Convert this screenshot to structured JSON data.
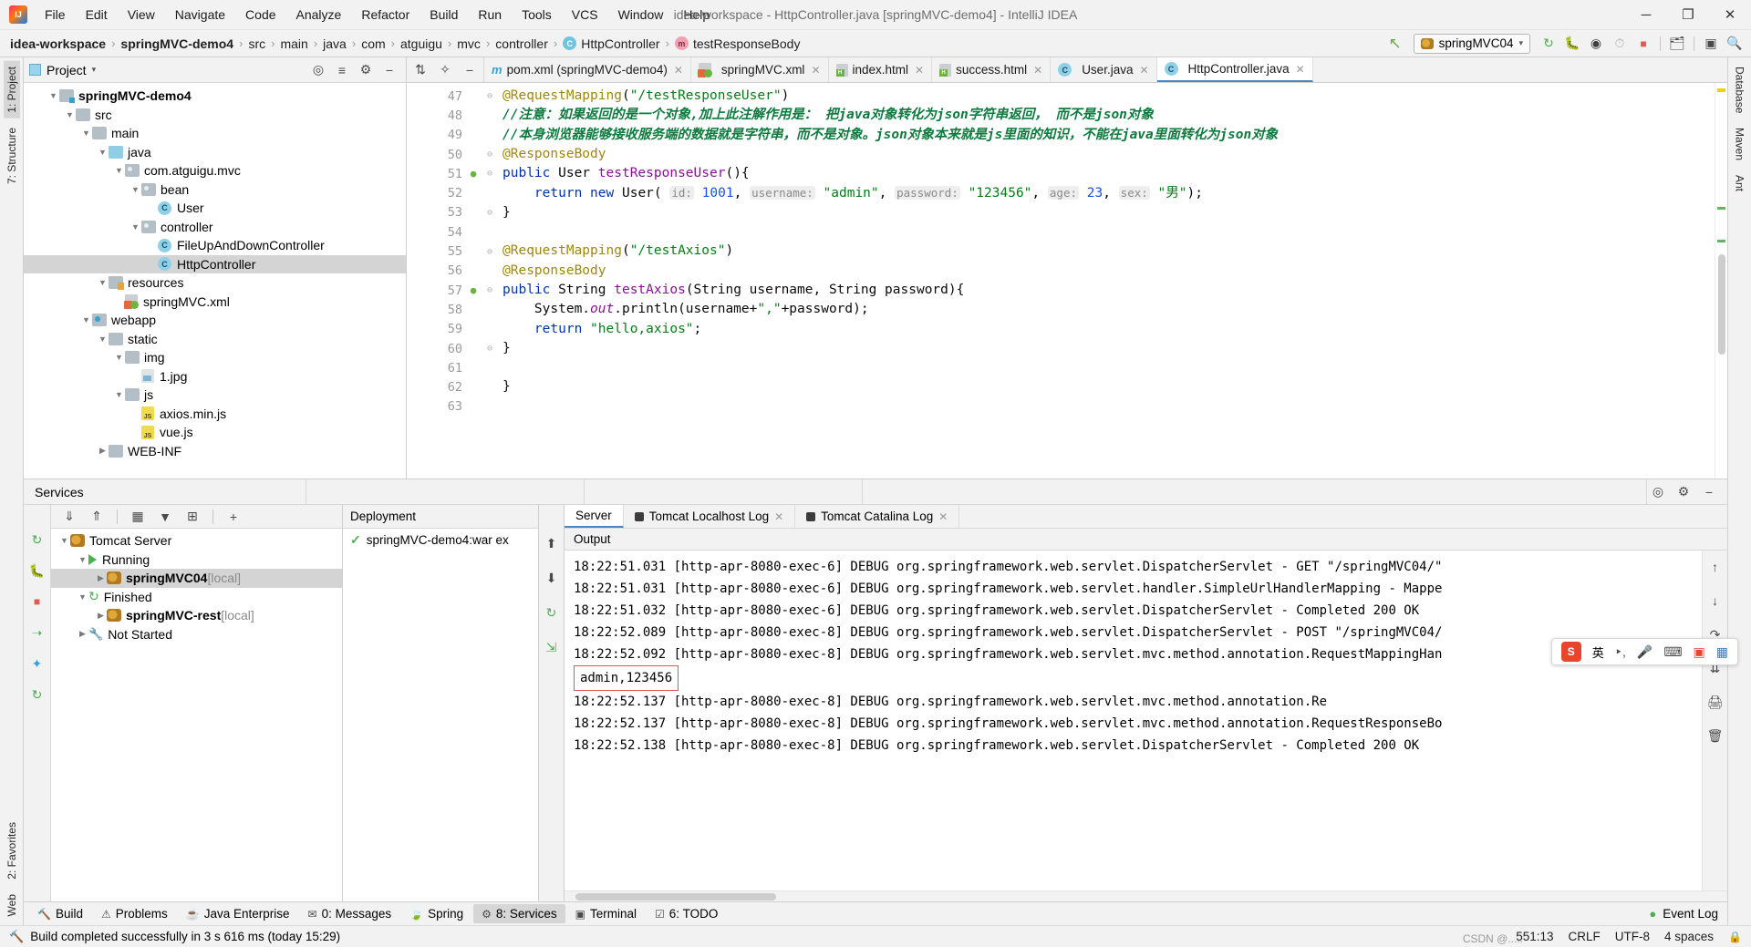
{
  "titlebar": {
    "logo": "intellij-logo",
    "menus": [
      "File",
      "Edit",
      "View",
      "Navigate",
      "Code",
      "Analyze",
      "Refactor",
      "Build",
      "Run",
      "Tools",
      "VCS",
      "Window",
      "Help"
    ],
    "window_title": "idea-workspace - HttpController.java [springMVC-demo4] - IntelliJ IDEA",
    "minimize": "─",
    "maximize": "❐",
    "close": "✕"
  },
  "navbar": {
    "crumbs": [
      {
        "label": "idea-workspace",
        "bold": true,
        "badge": ""
      },
      {
        "label": "springMVC-demo4",
        "bold": true,
        "badge": ""
      },
      {
        "label": "src",
        "bold": false,
        "badge": ""
      },
      {
        "label": "main",
        "bold": false,
        "badge": ""
      },
      {
        "label": "java",
        "bold": false,
        "badge": ""
      },
      {
        "label": "com",
        "bold": false,
        "badge": ""
      },
      {
        "label": "atguigu",
        "bold": false,
        "badge": ""
      },
      {
        "label": "mvc",
        "bold": false,
        "badge": ""
      },
      {
        "label": "controller",
        "bold": false,
        "badge": ""
      },
      {
        "label": "HttpController",
        "bold": false,
        "badge": "C"
      },
      {
        "label": "testResponseBody",
        "bold": false,
        "badge": "m"
      }
    ],
    "separator": "›",
    "run_config": "springMVC04",
    "run_config_caret": "▾",
    "actions": [
      "rerun-icon",
      "debug-icon",
      "run-with-coverage-icon",
      "profile-icon",
      "stop-icon",
      "build-project-icon",
      "terminal-icon",
      "search-everywhere-icon"
    ],
    "back_arrow": "↖"
  },
  "left_strip": {
    "top": [
      "1: Project",
      "7: Structure"
    ],
    "bottom": [
      "2: Favorites",
      "Web"
    ]
  },
  "right_strip": {
    "items": [
      "Database",
      "Maven",
      "Ant"
    ]
  },
  "project_panel": {
    "title": "Project",
    "caret": "▾",
    "header_actions": [
      "locate-icon",
      "collapse-all-icon",
      "settings-icon",
      "hide-icon"
    ],
    "tree": [
      {
        "depth": 1,
        "label": "springMVC-demo4",
        "icon": "module-folder",
        "arrow": "▼",
        "bold": true,
        "selected": false
      },
      {
        "depth": 2,
        "label": "src",
        "icon": "folder",
        "arrow": "▼",
        "bold": false,
        "selected": false
      },
      {
        "depth": 3,
        "label": "main",
        "icon": "folder",
        "arrow": "▼",
        "bold": false,
        "selected": false
      },
      {
        "depth": 4,
        "label": "java",
        "icon": "source-folder",
        "arrow": "▼",
        "bold": false,
        "selected": false
      },
      {
        "depth": 5,
        "label": "com.atguigu.mvc",
        "icon": "package",
        "arrow": "▼",
        "bold": false,
        "selected": false
      },
      {
        "depth": 6,
        "label": "bean",
        "icon": "package",
        "arrow": "▼",
        "bold": false,
        "selected": false
      },
      {
        "depth": 7,
        "label": "User",
        "icon": "java-class",
        "arrow": "",
        "bold": false,
        "selected": false
      },
      {
        "depth": 6,
        "label": "controller",
        "icon": "package",
        "arrow": "▼",
        "bold": false,
        "selected": false
      },
      {
        "depth": 7,
        "label": "FileUpAndDownController",
        "icon": "java-class",
        "arrow": "",
        "bold": false,
        "selected": false
      },
      {
        "depth": 7,
        "label": "HttpController",
        "icon": "java-class",
        "arrow": "",
        "bold": false,
        "selected": true
      },
      {
        "depth": 4,
        "label": "resources",
        "icon": "resource-folder",
        "arrow": "▼",
        "bold": false,
        "selected": false
      },
      {
        "depth": 5,
        "label": "springMVC.xml",
        "icon": "spring-xml",
        "arrow": "",
        "bold": false,
        "selected": false
      },
      {
        "depth": 3,
        "label": "webapp",
        "icon": "web-folder",
        "arrow": "▼",
        "bold": false,
        "selected": false
      },
      {
        "depth": 4,
        "label": "static",
        "icon": "folder",
        "arrow": "▼",
        "bold": false,
        "selected": false
      },
      {
        "depth": 5,
        "label": "img",
        "icon": "folder",
        "arrow": "▼",
        "bold": false,
        "selected": false
      },
      {
        "depth": 6,
        "label": "1.jpg",
        "icon": "image-file",
        "arrow": "",
        "bold": false,
        "selected": false
      },
      {
        "depth": 5,
        "label": "js",
        "icon": "folder",
        "arrow": "▼",
        "bold": false,
        "selected": false
      },
      {
        "depth": 6,
        "label": "axios.min.js",
        "icon": "js-file",
        "arrow": "",
        "bold": false,
        "selected": false
      },
      {
        "depth": 6,
        "label": "vue.js",
        "icon": "js-file",
        "arrow": "",
        "bold": false,
        "selected": false
      },
      {
        "depth": 4,
        "label": "WEB-INF",
        "icon": "folder",
        "arrow": "▶",
        "bold": false,
        "selected": false
      }
    ]
  },
  "editor": {
    "tab_actions": [
      "expand-icon",
      "pin-icon",
      "minimize-icon"
    ],
    "tabs": [
      {
        "label": "pom.xml (springMVC-demo4)",
        "icon": "maven-icon",
        "active": false,
        "close": "✕"
      },
      {
        "label": "springMVC.xml",
        "icon": "spring-xml-icon",
        "active": false,
        "close": "✕"
      },
      {
        "label": "index.html",
        "icon": "html-icon",
        "active": false,
        "close": "✕"
      },
      {
        "label": "success.html",
        "icon": "html-icon",
        "active": false,
        "close": "✕"
      },
      {
        "label": "User.java",
        "icon": "java-class-icon",
        "active": false,
        "close": "✕"
      },
      {
        "label": "HttpController.java",
        "icon": "java-class-icon",
        "active": true,
        "close": "✕"
      }
    ],
    "lines": [
      {
        "num": "47",
        "gutter_mark": "",
        "fold": "⊖",
        "html": "<span class='ann'>@RequestMapping</span>(<span class='str'>\"/testResponseUser\"</span>)"
      },
      {
        "num": "48",
        "gutter_mark": "",
        "fold": "",
        "html": "<span class='cmt'>//注意：如果返回的是一个对象,加上此注解作用是： 把java对象转化为json字符串返回， 而不是json对象</span>"
      },
      {
        "num": "49",
        "gutter_mark": "",
        "fold": "",
        "html": "<span class='cmt'>//本身浏览器能够接收服务端的数据就是字符串，而不是对象。json对象本来就是js里面的知识，不能在java里面转化为json对象</span>"
      },
      {
        "num": "50",
        "gutter_mark": "",
        "fold": "⊖",
        "html": "<span class='ann'>@ResponseBody</span>"
      },
      {
        "num": "51",
        "gutter_mark": "●",
        "fold": "⊖",
        "html": "<span class='kw'>public</span> User <span class='fld'>testResponseUser</span>(){"
      },
      {
        "num": "52",
        "gutter_mark": "",
        "fold": "",
        "html": "    <span class='kw'>return</span> <span class='kw'>new</span> User( <span class='hint'>id:</span> <span class='num'>1001</span>, <span class='hint'>username:</span> <span class='str'>\"admin\"</span>, <span class='hint'>password:</span> <span class='str'>\"123456\"</span>, <span class='hint'>age:</span> <span class='num'>23</span>, <span class='hint'>sex:</span> <span class='str'>\"男\"</span>);"
      },
      {
        "num": "53",
        "gutter_mark": "",
        "fold": "⊖",
        "html": "}"
      },
      {
        "num": "54",
        "gutter_mark": "",
        "fold": "",
        "html": ""
      },
      {
        "num": "55",
        "gutter_mark": "",
        "fold": "⊖",
        "html": "<span class='ann'>@RequestMapping</span>(<span class='str'>\"/testAxios\"</span>)"
      },
      {
        "num": "56",
        "gutter_mark": "",
        "fold": "",
        "html": "<span class='ann'>@ResponseBody</span>"
      },
      {
        "num": "57",
        "gutter_mark": "●",
        "fold": "⊖",
        "html": "<span class='kw'>public</span> String <span class='fld'>testAxios</span>(String username, String password){"
      },
      {
        "num": "58",
        "gutter_mark": "",
        "fold": "",
        "html": "    System.<span class='fld'><i>out</i></span>.println(username+<span class='str'>\",\"</span>+password);"
      },
      {
        "num": "59",
        "gutter_mark": "",
        "fold": "",
        "html": "    <span class='kw'>return</span> <span class='str'>\"hello,axios\"</span>;"
      },
      {
        "num": "60",
        "gutter_mark": "",
        "fold": "⊖",
        "html": "}"
      },
      {
        "num": "61",
        "gutter_mark": "",
        "fold": "",
        "html": ""
      },
      {
        "num": "62",
        "gutter_mark": "",
        "fold": "",
        "html": "}"
      },
      {
        "num": "63",
        "gutter_mark": "",
        "fold": "",
        "html": ""
      }
    ]
  },
  "services": {
    "title": "Services",
    "header_actions": [
      "help-icon",
      "settings-icon",
      "hide-icon"
    ],
    "toolbar_left": [
      "rerun-icon",
      "debug-icon",
      "stop-icon",
      "redeploy-icon",
      "configure-icon",
      "refresh-icon"
    ],
    "tree_toolbar": [
      "expand-all-icon",
      "collapse-all-icon",
      "group-icon",
      "filter-icon",
      "add-tab-icon",
      "add-icon"
    ],
    "tree": [
      {
        "depth": 0,
        "label": "Tomcat Server",
        "suffix": "",
        "arrow": "▼",
        "icon": "tomcat-icon",
        "bold": false,
        "selected": false
      },
      {
        "depth": 1,
        "label": "Running",
        "suffix": "",
        "arrow": "▼",
        "icon": "play-icon",
        "bold": false,
        "selected": false
      },
      {
        "depth": 2,
        "label": "springMVC04",
        "suffix": " [local]",
        "arrow": "▶",
        "icon": "tomcat-run-icon",
        "bold": true,
        "selected": true
      },
      {
        "depth": 1,
        "label": "Finished",
        "suffix": "",
        "arrow": "▼",
        "icon": "refresh-icon",
        "bold": false,
        "selected": false
      },
      {
        "depth": 2,
        "label": "springMVC-rest",
        "suffix": " [local]",
        "arrow": "▶",
        "icon": "tomcat-stop-icon",
        "bold": true,
        "selected": false
      },
      {
        "depth": 1,
        "label": "Not Started",
        "suffix": "",
        "arrow": "▶",
        "icon": "wrench-icon",
        "bold": false,
        "selected": false
      }
    ],
    "deployment": {
      "header": "Deployment",
      "item": "springMVC-demo4:war ex",
      "status_icon": "check-icon"
    },
    "deployment_actions": [
      "deploy-icon",
      "undeploy-icon",
      "redeploy-icon",
      "redeploy-all-icon"
    ],
    "console_tabs": [
      {
        "label": "Server",
        "icon": "",
        "active": true
      },
      {
        "label": "Tomcat Localhost Log",
        "icon": "log-icon",
        "active": false,
        "close": "✕"
      },
      {
        "label": "Tomcat Catalina Log",
        "icon": "log-icon",
        "active": false,
        "close": "✕"
      }
    ],
    "output_header": "Output",
    "console_lines": [
      "18:22:51.031 [http-apr-8080-exec-6] DEBUG org.springframework.web.servlet.DispatcherServlet - GET \"/springMVC04/\"",
      "18:22:51.031 [http-apr-8080-exec-6] DEBUG org.springframework.web.servlet.handler.SimpleUrlHandlerMapping - Mappe",
      "18:22:51.032 [http-apr-8080-exec-6] DEBUG org.springframework.web.servlet.DispatcherServlet - Completed 200 OK",
      "18:22:52.089 [http-apr-8080-exec-8] DEBUG org.springframework.web.servlet.DispatcherServlet - POST \"/springMVC04/",
      "18:22:52.092 [http-apr-8080-exec-8] DEBUG org.springframework.web.servlet.mvc.method.annotation.RequestMappingHan"
    ],
    "stdout_highlight": "admin,123456",
    "console_lines_after": [
      "18:22:52.137 [http-apr-8080-exec-8] DEBUG org.springframework.web.servlet.mvc.method.annotation.Re",
      "18:22:52.137 [http-apr-8080-exec-8] DEBUG org.springframework.web.servlet.mvc.method.annotation.RequestResponseBo",
      "18:22:52.138 [http-apr-8080-exec-8] DEBUG org.springframework.web.servlet.DispatcherServlet - Completed 200 OK"
    ],
    "console_side_actions": [
      "scroll-up-icon",
      "scroll-down-icon",
      "soft-wrap-icon",
      "scroll-to-end-icon",
      "print-icon",
      "clear-all-icon"
    ]
  },
  "bottom_tabs": {
    "items": [
      {
        "label": "Build",
        "icon": "build-icon",
        "selected": false
      },
      {
        "label": "Problems",
        "icon": "problems-icon",
        "selected": false
      },
      {
        "label": "Java Enterprise",
        "icon": "java-enterprise-icon",
        "selected": false
      },
      {
        "label": "0: Messages",
        "icon": "messages-icon",
        "selected": false
      },
      {
        "label": "Spring",
        "icon": "spring-icon",
        "selected": false
      },
      {
        "label": "8: Services",
        "icon": "services-icon",
        "selected": true
      },
      {
        "label": "Terminal",
        "icon": "terminal-icon",
        "selected": false
      },
      {
        "label": "6: TODO",
        "icon": "todo-icon",
        "selected": false
      }
    ],
    "event_log": "Event Log",
    "event_log_icon": "event-log-icon"
  },
  "statusbar": {
    "message": "Build completed successfully in 3 s 616 ms (today 15:29)",
    "build_icon": "hammer-icon",
    "caret_position": "551:13",
    "line_separator": "CRLF",
    "encoding": "UTF-8",
    "indent": "4 spaces",
    "lock_icon": "ὑ2"
  },
  "ime": {
    "logo": "S",
    "mode": "英",
    "items": [
      "expand-icon",
      "mic-icon",
      "keyboard-icon",
      "toolbox-icon",
      "apps-icon"
    ]
  },
  "watermark": "CSDN @.....",
  "colors": {
    "accent": "#4a86c8",
    "selection": "#d4d4d4",
    "panel_bg": "#f2f2f2",
    "editor_bg": "#ffffff",
    "keyword": "#0033b3",
    "string": "#067d17",
    "comment": "#0d7a3e",
    "annotation": "#9e880d",
    "number": "#1750eb",
    "error_box": "#e0584a",
    "green": "#4caf50"
  }
}
